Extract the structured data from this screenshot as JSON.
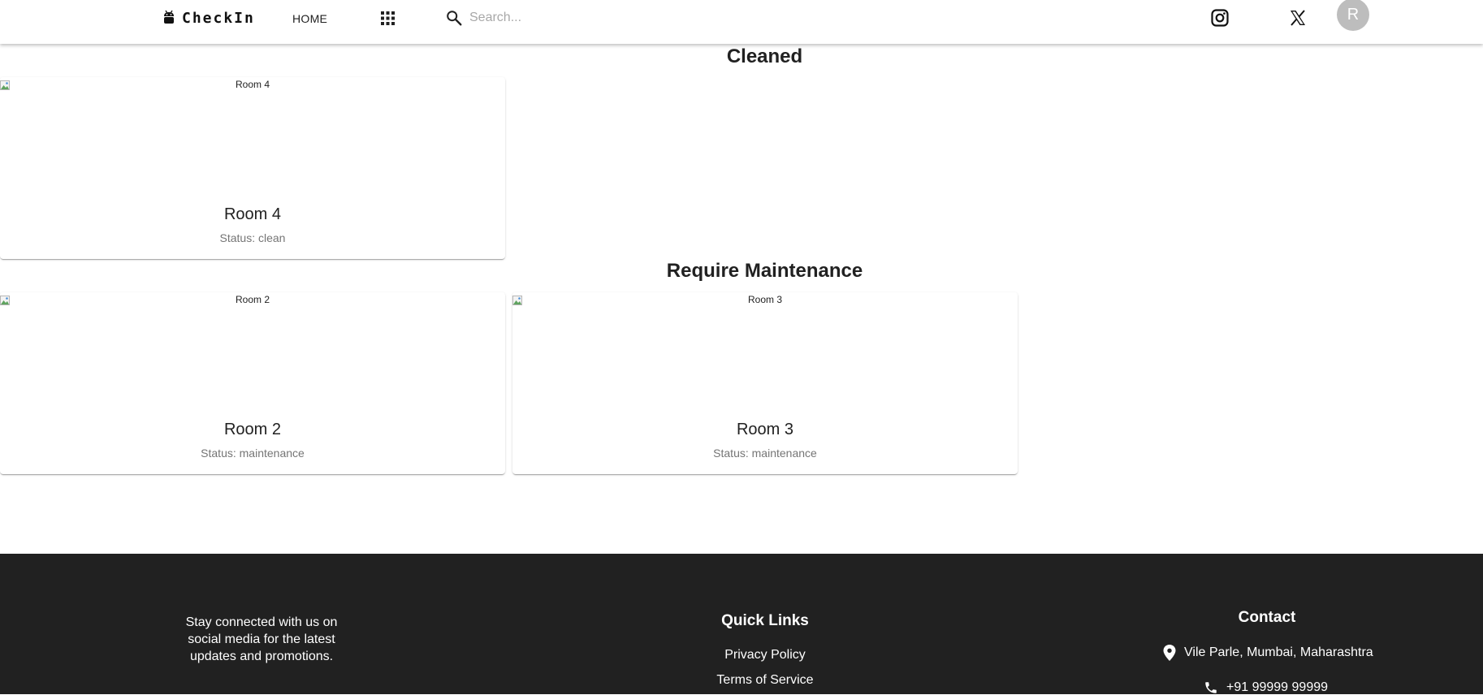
{
  "header": {
    "brand": "CheckIn",
    "nav_home": "HOME",
    "search_placeholder": "Search...",
    "avatar_initial": "R"
  },
  "sections": [
    {
      "title": "Cleaned",
      "rooms": [
        {
          "image_alt": "Room 4",
          "name": "Room 4",
          "status": "Status: clean"
        }
      ]
    },
    {
      "title": "Require Maintenance",
      "rooms": [
        {
          "image_alt": "Room 2",
          "name": "Room 2",
          "status": "Status: maintenance"
        },
        {
          "image_alt": "Room 3",
          "name": "Room 3",
          "status": "Status: maintenance"
        }
      ]
    }
  ],
  "footer": {
    "about": "Stay connected with us on social media for the latest updates and promotions.",
    "quick_links_title": "Quick Links",
    "links": [
      "Privacy Policy",
      "Terms of Service"
    ],
    "contact_title": "Contact",
    "address": "Vile Parle, Mumbai, Maharashtra",
    "phone": "+91 99999 99999"
  },
  "icons": {
    "brand": "android-icon",
    "apps": "apps-grid-icon",
    "search": "search-icon",
    "social": [
      "instagram-icon",
      "x-twitter-icon"
    ],
    "address": "location-pin-icon",
    "phone": "phone-icon"
  },
  "colors": {
    "footer_bg": "#212121",
    "avatar_bg": "#bdbdbd",
    "status_text": "#757575"
  }
}
